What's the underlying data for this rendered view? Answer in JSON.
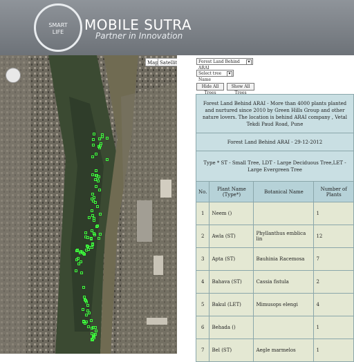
{
  "header": {
    "logo_text": [
      "SMART",
      "LIFE"
    ],
    "brand": "MOBILE SUTRA",
    "tagline": "Partner in Innovation"
  },
  "map": {
    "buttons": [
      "Map",
      "Satellite"
    ]
  },
  "controls": {
    "location_select": "Forest Land Behind ARAI",
    "tree_select": "Select tree Name",
    "hide_button": "Hide All Trees",
    "show_button": "Show All Trees"
  },
  "info": {
    "description": "Forest Land Behind ARAI - More than 4000 plants planted and nurtured since 2010 by Green Hills Group and other nature lovers. The location is behind ARAI company , Vetal Tekdi Paud Road, Pune",
    "title": "Forest Land Behind ARAI - 29-12-2012",
    "type_legend": "Type * ST - Small Tree, LDT - Large Deciduous Tree,LET - Large Evergreen Tree"
  },
  "table": {
    "headers": [
      "No.",
      "Plant Name (Type*)",
      "Botanical Name",
      "Number of Plants"
    ],
    "rows": [
      [
        "1",
        "Neem ()",
        "",
        "1"
      ],
      [
        "2",
        "Awla (ST)",
        "Phyllanthus emblica lin",
        "12"
      ],
      [
        "3",
        "Apta (ST)",
        "Bauhinia Racemosa",
        "7"
      ],
      [
        "4",
        "Bahava (ST)",
        "Cassia fistula",
        "2"
      ],
      [
        "5",
        "Bakul (LET)",
        "Mimusops elengi",
        "4"
      ],
      [
        "6",
        "Behada ()",
        "",
        "1"
      ],
      [
        "7",
        "Bel (ST)",
        "Aegle marmelos",
        "1"
      ]
    ]
  },
  "colors": {
    "header_bg": "#7e8389",
    "table_header": "#b6d2d8",
    "table_cell": "#e4e8d3",
    "tree_marker": "#3cff3c"
  }
}
